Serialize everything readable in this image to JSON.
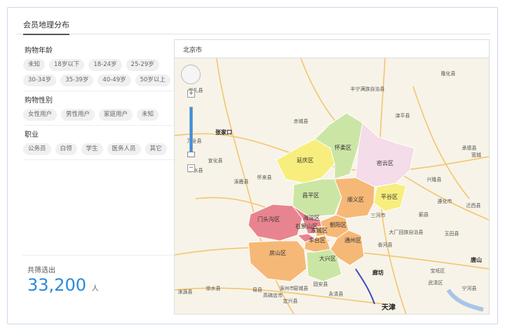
{
  "panel": {
    "title": "会员地理分布"
  },
  "filters": [
    {
      "title": "购物年龄",
      "options": [
        "未知",
        "18岁以下",
        "18-24岁",
        "25-29岁",
        "30-34岁",
        "35-39岁",
        "40-49岁",
        "50岁以上"
      ]
    },
    {
      "title": "购物性别",
      "options": [
        "女性用户",
        "男性用户",
        "家庭用户",
        "未知"
      ]
    },
    {
      "title": "职业",
      "options": [
        "公务员",
        "白领",
        "学生",
        "医务人员",
        "其它"
      ]
    }
  ],
  "summary": {
    "label": "共筛选出",
    "value": "33,200",
    "unit": "人"
  },
  "map": {
    "title": "北京市",
    "controls": {
      "zoom_in": "+",
      "zoom_out": "−"
    },
    "districts": [
      {
        "name": "延庆区",
        "color": "#f7ee7d"
      },
      {
        "name": "怀柔区",
        "color": "#cbe6a4"
      },
      {
        "name": "密云区",
        "color": "#f4dce8"
      },
      {
        "name": "平谷区",
        "color": "#f7ee7d"
      },
      {
        "name": "昌平区",
        "color": "#cbe6a4"
      },
      {
        "name": "顺义区",
        "color": "#f6b877"
      },
      {
        "name": "门头沟区",
        "color": "#e8848f"
      },
      {
        "name": "海淀区",
        "color": "#e8848f"
      },
      {
        "name": "石景山区",
        "color": "#e8848f"
      },
      {
        "name": "朝阳区",
        "color": "#f6b877"
      },
      {
        "name": "东城区",
        "color": "#f6b877"
      },
      {
        "name": "丰台区",
        "color": "#f6b877"
      },
      {
        "name": "通州区",
        "color": "#f6b877"
      },
      {
        "name": "房山区",
        "color": "#f6b877"
      },
      {
        "name": "大兴区",
        "color": "#cbe6a4"
      }
    ],
    "places": [
      "隆化县",
      "丰宁满族自治县",
      "滦平县",
      "赤城县",
      "张家口",
      "万全县",
      "崇礼县",
      "宣化县",
      "怀来县",
      "涿鹿县",
      "兴隆县",
      "承德县",
      "宽城",
      "三河市",
      "大厂回族自治县",
      "香河县",
      "廊坊",
      "天津",
      "涿州市",
      "高碑店市",
      "易县",
      "定兴县",
      "固安县",
      "永清县",
      "蓟县",
      "玉田县",
      "遵化市",
      "迁西县",
      "唐山",
      "宝坻区",
      "武清区",
      "宁河县",
      "涞水县",
      "徐水县",
      "容城县",
      "涞源县"
    ]
  }
}
